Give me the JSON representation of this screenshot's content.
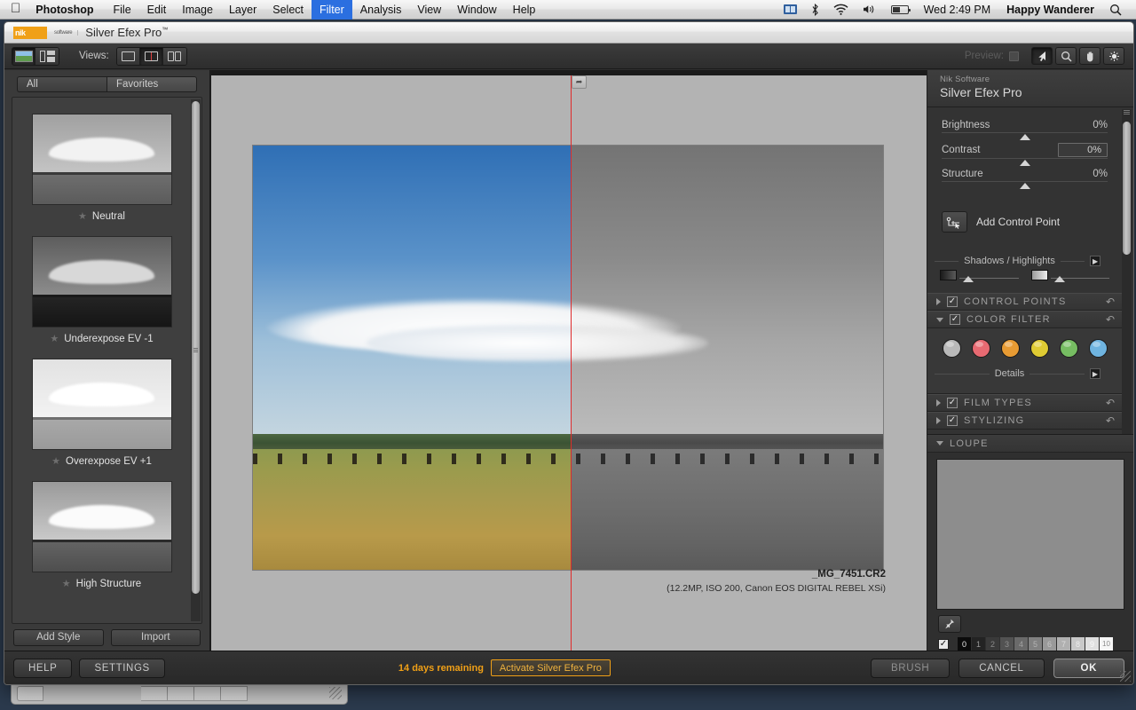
{
  "menubar": {
    "apple_icon": "apple-icon",
    "items": [
      "Photoshop",
      "File",
      "Edit",
      "Image",
      "Layer",
      "Select",
      "Filter",
      "Analysis",
      "View",
      "Window",
      "Help"
    ],
    "active_item": "Filter",
    "status": {
      "display_icon": "display-icon",
      "bluetooth_icon": "bluetooth-icon",
      "wifi_icon": "wifi-icon",
      "volume_icon": "volume-icon",
      "battery_icon": "battery-icon",
      "clock": "Wed 2:49 PM",
      "user": "Happy Wanderer",
      "search_icon": "spotlight-search-icon"
    }
  },
  "window": {
    "logo_text": "nik",
    "logo_sub": "software",
    "title": "Silver Efex Pro",
    "title_tm": "™"
  },
  "toolbar": {
    "image_view_icon": "image-view-icon",
    "grid_view_icon": "grid-view-icon",
    "views_label": "Views:",
    "view_modes": [
      "single-view-icon",
      "split-view-icon",
      "side-by-side-view-icon"
    ],
    "view_selected_index": 1,
    "preview_label": "Preview:",
    "preview_chip_icon": "preview-toggle-icon",
    "tools": [
      "pointer-tool-icon",
      "zoom-tool-icon",
      "hand-tool-icon",
      "brush-tool-icon"
    ],
    "tool_selected_index": 0
  },
  "presets": {
    "tabs": [
      "All",
      "Favorites"
    ],
    "selected_tab": "Favorites",
    "items": [
      {
        "name": "Neutral",
        "star_icon": "star-icon",
        "tone": "neutral"
      },
      {
        "name": "Underexpose EV -1",
        "star_icon": "star-icon",
        "tone": "under"
      },
      {
        "name": "Overexpose EV +1",
        "star_icon": "star-icon",
        "tone": "over"
      },
      {
        "name": "High Structure",
        "star_icon": "star-icon",
        "tone": "structure"
      }
    ],
    "footer": {
      "add_style": "Add Style",
      "import": "Import"
    }
  },
  "canvas": {
    "split_handle_icon": "split-handle-icon",
    "split_line_color": "#e02b2b",
    "photo": {
      "filename": "_MG_7451.CR2",
      "metadata": "(12.2MP, ISO 200, Canon EOS DIGITAL REBEL XSi)"
    }
  },
  "right_panel": {
    "brand": "Nik Software",
    "product": "Silver Efex Pro",
    "sliders": [
      {
        "name": "Brightness",
        "value": "0%",
        "boxed": false
      },
      {
        "name": "Contrast",
        "value": "0%",
        "boxed": true
      },
      {
        "name": "Structure",
        "value": "0%",
        "boxed": false
      }
    ],
    "control_point": {
      "label": "Add Control Point",
      "icon": "add-control-point-icon"
    },
    "shadows_highlights": {
      "label": "Shadows / Highlights",
      "expand_icon": "expand-arrow-icon"
    },
    "details": {
      "label": "Details",
      "expand_icon": "expand-arrow-icon"
    },
    "sections": [
      {
        "title": "CONTROL POINTS",
        "checked": true,
        "expanded": false,
        "reset_icon": "reset-arrow-icon"
      },
      {
        "title": "COLOR FILTER",
        "checked": true,
        "expanded": true,
        "reset_icon": "reset-arrow-icon"
      },
      {
        "title": "FILM TYPES",
        "checked": true,
        "expanded": false,
        "reset_icon": "reset-arrow-icon"
      },
      {
        "title": "STYLIZING",
        "checked": true,
        "expanded": false,
        "reset_icon": "reset-arrow-icon"
      }
    ],
    "color_filters": [
      {
        "name": "neutral-filter",
        "color": "#b9b9b9"
      },
      {
        "name": "red-filter",
        "color": "#e86a72"
      },
      {
        "name": "orange-filter",
        "color": "#e89b33"
      },
      {
        "name": "yellow-filter",
        "color": "#dfcb33"
      },
      {
        "name": "green-filter",
        "color": "#76bd62"
      },
      {
        "name": "blue-filter",
        "color": "#6fb4e0"
      }
    ]
  },
  "loupe": {
    "title": "LOUPE",
    "pin_icon": "pin-icon",
    "checkbox_checked": true,
    "zones": [
      "0",
      "1",
      "2",
      "3",
      "4",
      "5",
      "6",
      "7",
      "8",
      "9",
      "10"
    ],
    "zone_colors": [
      "#0b0b0b",
      "#232323",
      "#3a3a3a",
      "#525252",
      "#6a6a6a",
      "#818181",
      "#999999",
      "#b0b0b0",
      "#c8c8c8",
      "#e0e0e0",
      "#f6f6f6"
    ],
    "selected_zone": "0"
  },
  "footer": {
    "help": "HELP",
    "settings": "SETTINGS",
    "trial_days": "14 days remaining",
    "activate": "Activate Silver Efex Pro",
    "brush": "BRUSH",
    "cancel": "CANCEL",
    "ok": "OK"
  }
}
